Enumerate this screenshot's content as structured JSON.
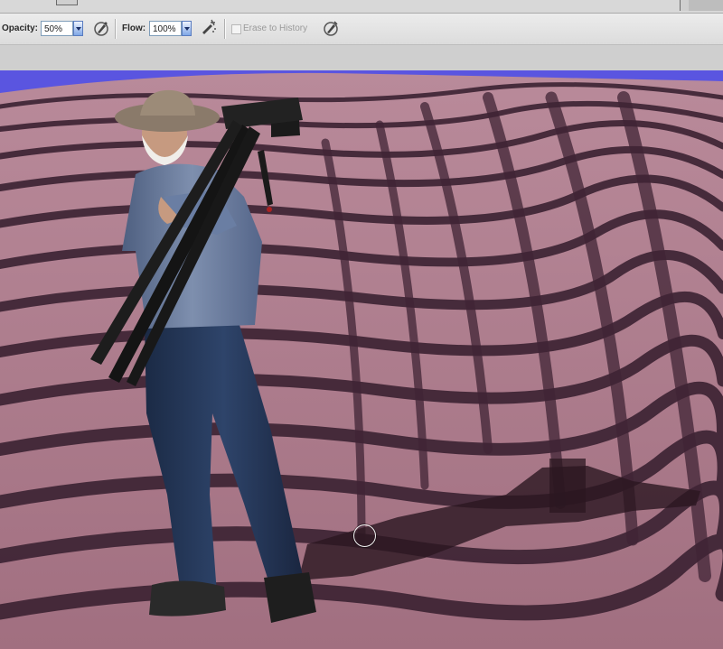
{
  "options_bar": {
    "opacity_label": "Opacity:",
    "opacity_value": "50%",
    "flow_label": "Flow:",
    "flow_value": "100%",
    "erase_to_history_label": "Erase to History",
    "erase_to_history_checked": false,
    "icons": [
      "airbrush-pressure-icon",
      "airbrush-icon",
      "tablet-pressure-icon"
    ]
  },
  "colors": {
    "toolbar_bg": "#e4e4e4",
    "canvas_backdrop": "#5a55e0",
    "sand": "#b07a8c",
    "sand_shadow": "#3e2233"
  },
  "canvas": {
    "subject": "man-with-tripod",
    "brush_cursor": "circle"
  }
}
